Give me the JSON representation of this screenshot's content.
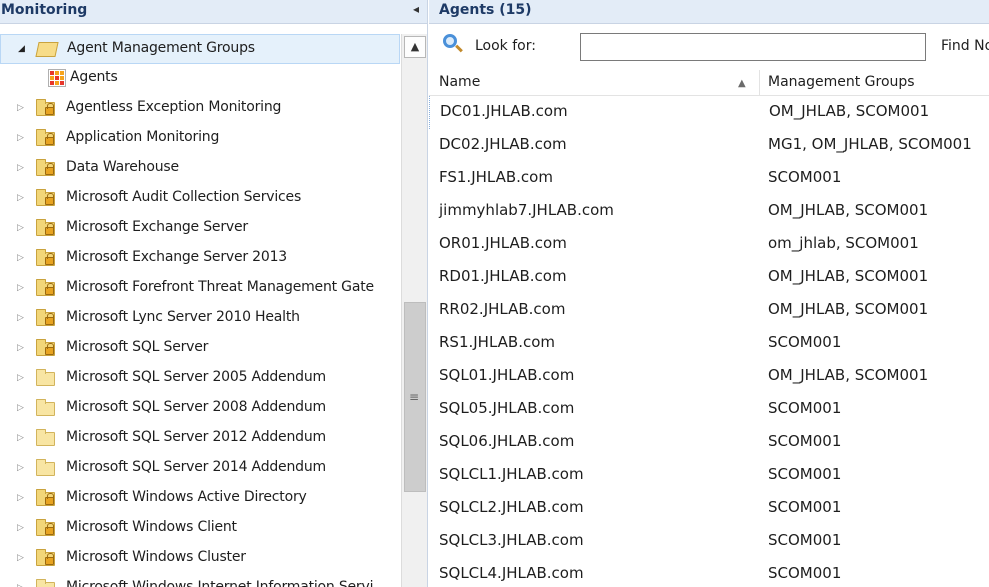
{
  "left_pane": {
    "title": "Monitoring",
    "collapse_glyph": "◂",
    "scroll_up_glyph": "▲",
    "scroll_grip_glyph": "≡",
    "tree": [
      {
        "label": "Agent Management Groups",
        "icon": "open-folder-icon",
        "expander": "expanded",
        "selected": true
      },
      {
        "label": "Agents",
        "icon": "grid-view-icon",
        "expander": "none"
      },
      {
        "label": "Agentless Exception Monitoring",
        "icon": "locked-folder-icon",
        "expander": "collapsed"
      },
      {
        "label": "Application Monitoring",
        "icon": "locked-folder-icon",
        "expander": "collapsed"
      },
      {
        "label": "Data Warehouse",
        "icon": "locked-folder-icon",
        "expander": "collapsed"
      },
      {
        "label": "Microsoft Audit Collection Services",
        "icon": "locked-folder-icon",
        "expander": "collapsed"
      },
      {
        "label": "Microsoft Exchange Server",
        "icon": "locked-folder-icon",
        "expander": "collapsed"
      },
      {
        "label": "Microsoft Exchange Server 2013",
        "icon": "locked-folder-icon",
        "expander": "collapsed"
      },
      {
        "label": "Microsoft Forefront Threat Management Gate",
        "icon": "locked-folder-icon",
        "expander": "collapsed"
      },
      {
        "label": "Microsoft Lync Server 2010 Health",
        "icon": "locked-folder-icon",
        "expander": "collapsed"
      },
      {
        "label": "Microsoft SQL Server",
        "icon": "locked-folder-icon",
        "expander": "collapsed"
      },
      {
        "label": "Microsoft SQL Server 2005 Addendum",
        "icon": "folder-icon",
        "expander": "collapsed"
      },
      {
        "label": "Microsoft SQL Server 2008 Addendum",
        "icon": "folder-icon",
        "expander": "collapsed"
      },
      {
        "label": "Microsoft SQL Server 2012 Addendum",
        "icon": "folder-icon",
        "expander": "collapsed"
      },
      {
        "label": "Microsoft SQL Server 2014 Addendum",
        "icon": "folder-icon",
        "expander": "collapsed"
      },
      {
        "label": "Microsoft Windows Active Directory",
        "icon": "locked-folder-icon",
        "expander": "collapsed"
      },
      {
        "label": "Microsoft Windows Client",
        "icon": "locked-folder-icon",
        "expander": "collapsed"
      },
      {
        "label": "Microsoft Windows Cluster",
        "icon": "locked-folder-icon",
        "expander": "collapsed"
      },
      {
        "label": "Microsoft Windows Internet Information Servi",
        "icon": "folder-icon",
        "expander": "collapsed"
      }
    ]
  },
  "right_pane": {
    "title": "Agents (15)",
    "search": {
      "label": "Look for:",
      "value": "",
      "placeholder": "",
      "find_label": "Find Now"
    },
    "columns": {
      "name": "Name",
      "management_groups": "Management Groups",
      "sort_glyph": "▲"
    },
    "rows": [
      {
        "name": "DC01.JHLAB.com",
        "groups": "OM_JHLAB, SCOM001"
      },
      {
        "name": "DC02.JHLAB.com",
        "groups": "MG1, OM_JHLAB, SCOM001"
      },
      {
        "name": "FS1.JHLAB.com",
        "groups": "SCOM001"
      },
      {
        "name": "jimmyhlab7.JHLAB.com",
        "groups": "OM_JHLAB, SCOM001"
      },
      {
        "name": "OR01.JHLAB.com",
        "groups": "om_jhlab, SCOM001"
      },
      {
        "name": "RD01.JHLAB.com",
        "groups": "OM_JHLAB, SCOM001"
      },
      {
        "name": "RR02.JHLAB.com",
        "groups": "OM_JHLAB, SCOM001"
      },
      {
        "name": "RS1.JHLAB.com",
        "groups": "SCOM001"
      },
      {
        "name": "SQL01.JHLAB.com",
        "groups": "OM_JHLAB, SCOM001"
      },
      {
        "name": "SQL05.JHLAB.com",
        "groups": "SCOM001"
      },
      {
        "name": "SQL06.JHLAB.com",
        "groups": "SCOM001"
      },
      {
        "name": "SQLCL1.JHLAB.com",
        "groups": "SCOM001"
      },
      {
        "name": "SQLCL2.JHLAB.com",
        "groups": "SCOM001"
      },
      {
        "name": "SQLCL3.JHLAB.com",
        "groups": "SCOM001"
      },
      {
        "name": "SQLCL4.JHLAB.com",
        "groups": "SCOM001"
      }
    ]
  },
  "colors": {
    "header_bg": "#e3ecf7",
    "header_text": "#1e3a66",
    "selection": "#e5f1fb",
    "search_accent": "#4a90d9"
  }
}
